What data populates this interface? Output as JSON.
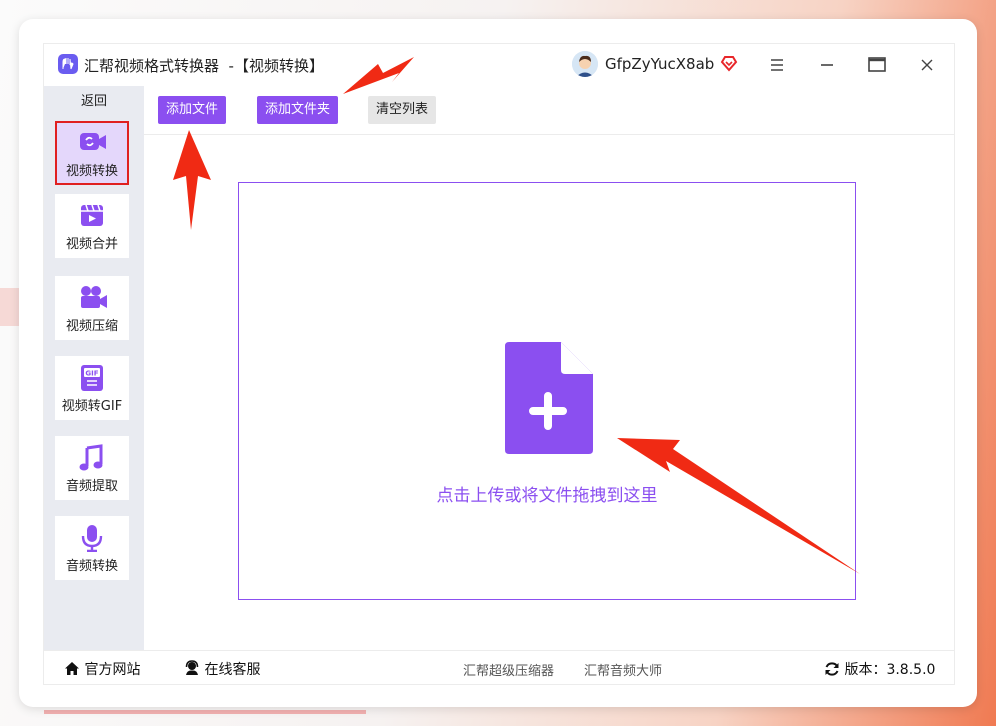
{
  "app": {
    "title": "汇帮视频格式转换器  -【视频转换】",
    "username": "GfpZyYucX8ab"
  },
  "window_controls": {
    "menu_icon": "hamburger-menu-icon",
    "minimize_icon": "minimize-icon",
    "maximize_icon": "maximize-icon",
    "close_icon": "close-icon"
  },
  "sidebar": {
    "back_label": "返回",
    "items": [
      {
        "label": "视频转换",
        "icon": "video-convert-icon",
        "active": true
      },
      {
        "label": "视频合并",
        "icon": "video-merge-icon",
        "active": false
      },
      {
        "label": "视频压缩",
        "icon": "video-camera-icon",
        "active": false
      },
      {
        "label": "视频转GIF",
        "icon": "gif-icon",
        "active": false
      },
      {
        "label": "音频提取",
        "icon": "music-note-icon",
        "active": false
      },
      {
        "label": "音频转换",
        "icon": "microphone-icon",
        "active": false
      }
    ]
  },
  "toolbar": {
    "add_file": "添加文件",
    "add_folder": "添加文件夹",
    "clear_list": "清空列表"
  },
  "dropzone": {
    "text": "点击上传或将文件拖拽到这里",
    "icon": "add-file-icon"
  },
  "statusbar": {
    "website": "官方网站",
    "support": "在线客服",
    "link1": "汇帮超级压缩器",
    "link2": "汇帮音频大师",
    "version": "版本：3.8.5.0"
  },
  "colors": {
    "accent": "#8b4ff0",
    "active_border": "#e02020",
    "sidebar_bg": "#e9ebf1",
    "arrow": "#f02a14"
  }
}
